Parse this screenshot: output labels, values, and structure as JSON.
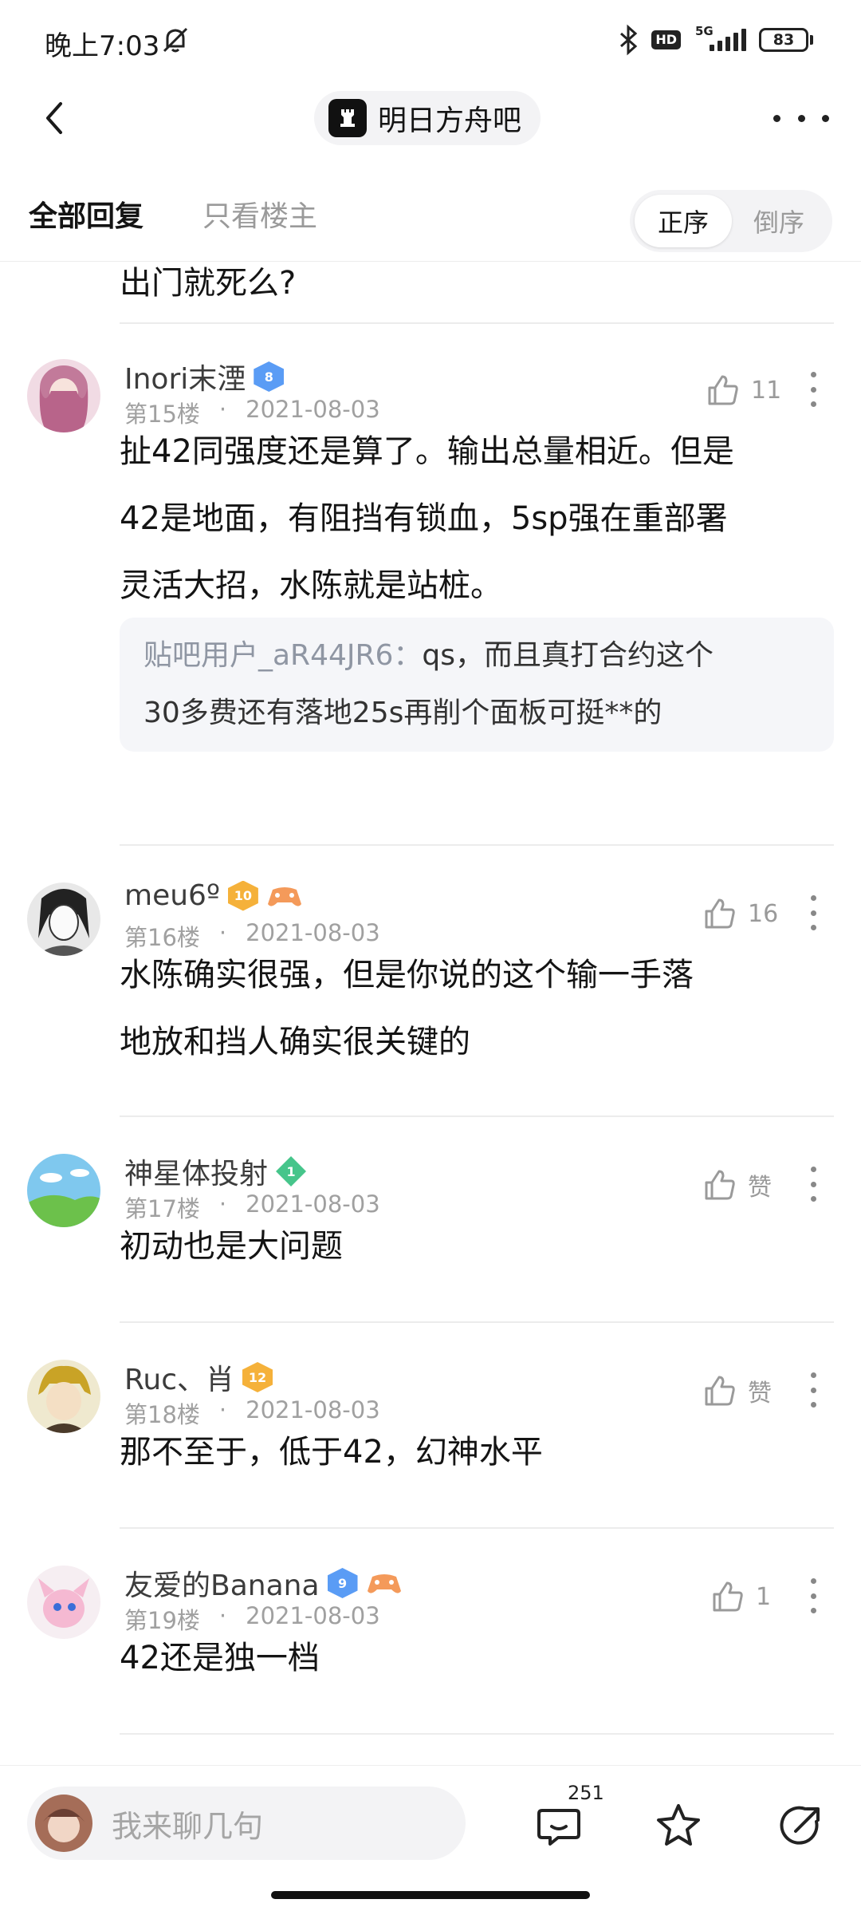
{
  "status_bar": {
    "time": "晚上7:03",
    "hd": "HD",
    "network": "5G",
    "battery": "83"
  },
  "nav": {
    "forum_name": "明日方舟吧"
  },
  "tabs": {
    "all_replies": "全部回复",
    "op_only": "只看楼主",
    "sort_asc": "正序",
    "sort_desc": "倒序"
  },
  "prev_tail": "出门就死么?",
  "posts": [
    {
      "username": "Inori末湮",
      "level": "8",
      "floor": "第15楼",
      "sep": "·",
      "date": "2021-08-03",
      "likes": "11",
      "text_lines": [
        "扯42同强度还是算了。输出总量相近。但是",
        "42是地面，有阻挡有锁血，5sp强在重部署",
        "灵活大招，水陈就是站桩。"
      ],
      "reply": {
        "user": "贴吧用户_aR44JR6：",
        "line1": "qs，而且真打合约这个",
        "line2": "30多费还有落地25s再削个面板可挺**的"
      }
    },
    {
      "username": "meu6º",
      "level": "10",
      "floor": "第16楼",
      "sep": "·",
      "date": "2021-08-03",
      "likes": "16",
      "text_lines": [
        "水陈确实很强，但是你说的这个输一手落",
        "地放和挡人确实很关键的"
      ]
    },
    {
      "username": "神星体投射",
      "level": "1",
      "floor": "第17楼",
      "sep": "·",
      "date": "2021-08-03",
      "likes": "赞",
      "text_lines": [
        "初动也是大问题"
      ]
    },
    {
      "username": "Ruc、肖",
      "level": "12",
      "floor": "第18楼",
      "sep": "·",
      "date": "2021-08-03",
      "likes": "赞",
      "text_lines": [
        "那不至于，低于42，幻神水平"
      ]
    },
    {
      "username": "友爱的Banana",
      "level": "9",
      "floor": "第19楼",
      "sep": "·",
      "date": "2021-08-03",
      "likes": "1",
      "text_lines": [
        "42还是独一档"
      ]
    }
  ],
  "bottom_bar": {
    "input_placeholder": "我来聊几句",
    "comment_count": "251"
  },
  "icons": [
    "bell-off-icon",
    "bluetooth-icon",
    "back-arrow-icon",
    "more-icon",
    "thumb-up-icon",
    "kebab-icon",
    "comment-icon",
    "star-icon",
    "share-icon"
  ],
  "colors": {
    "text": "#141414",
    "muted": "#a0a0a0",
    "badge_blue": "#5a9cf5",
    "badge_orange": "#f5b13a",
    "badge_green": "#46c58b"
  }
}
